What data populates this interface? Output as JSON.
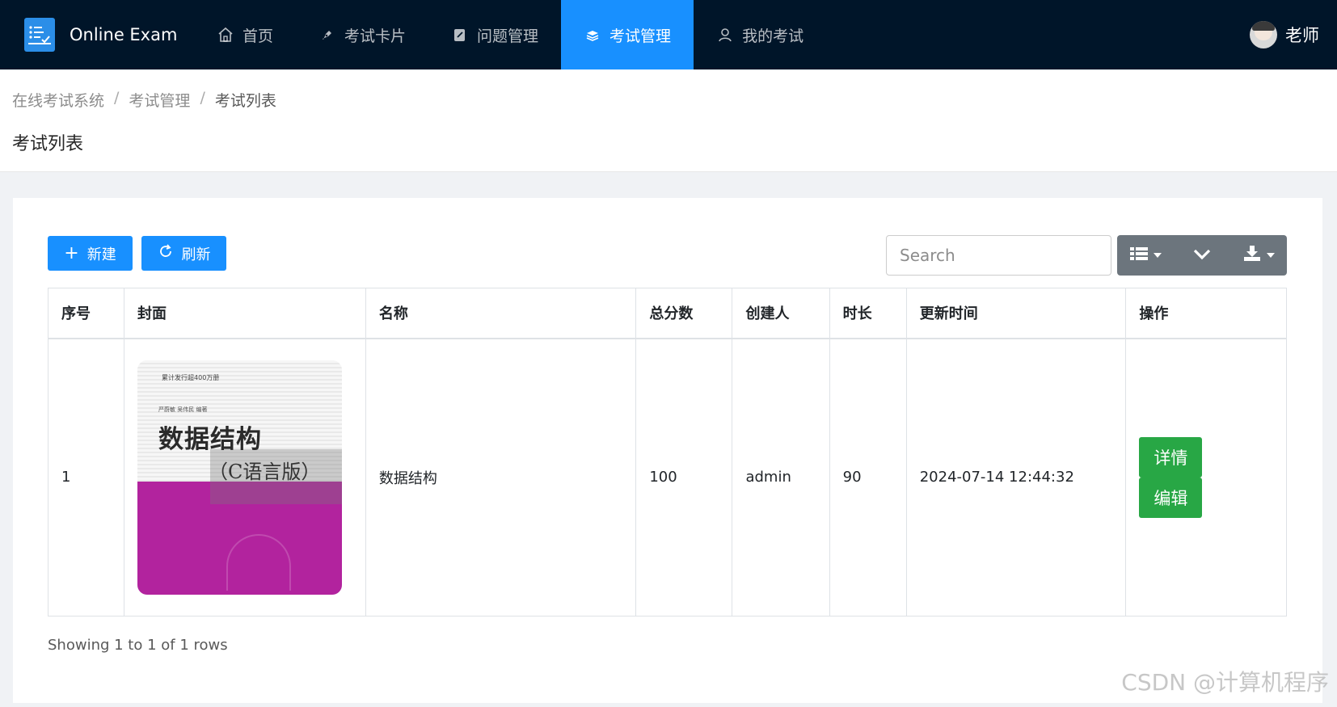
{
  "header": {
    "brand": "Online Exam",
    "nav": [
      {
        "label": "首页",
        "icon": "home-icon"
      },
      {
        "label": "考试卡片",
        "icon": "pen-icon"
      },
      {
        "label": "问题管理",
        "icon": "edit-icon"
      },
      {
        "label": "考试管理",
        "icon": "stack-icon",
        "active": true
      },
      {
        "label": "我的考试",
        "icon": "user-icon"
      }
    ],
    "user_name": "老师"
  },
  "breadcrumb": [
    "在线考试系统",
    "考试管理",
    "考试列表"
  ],
  "page_title": "考试列表",
  "toolbar": {
    "new_label": "新建",
    "refresh_label": "刷新",
    "search_placeholder": "Search"
  },
  "table": {
    "columns": [
      "序号",
      "封面",
      "名称",
      "总分数",
      "创建人",
      "时长",
      "更新时间",
      "操作"
    ],
    "rows": [
      {
        "index": "1",
        "cover": {
          "line1": "累计发行超400万册",
          "line2": "严蔚敏  吴伟民  编著",
          "title": "数据结构",
          "subtitle": "（C语言版）"
        },
        "name": "数据结构",
        "total_score": "100",
        "creator": "admin",
        "duration": "90",
        "updated_at": "2024-07-14 12:44:32",
        "detail_label": "详情",
        "edit_label": "编辑"
      }
    ]
  },
  "pagination_text": "Showing 1 to 1 of 1 rows",
  "watermark": "CSDN @计算机程序",
  "colors": {
    "header_bg": "#001529",
    "active_nav": "#1890ff",
    "primary": "#1890ff",
    "success": "#28a745",
    "tool_group": "#6c757d"
  }
}
